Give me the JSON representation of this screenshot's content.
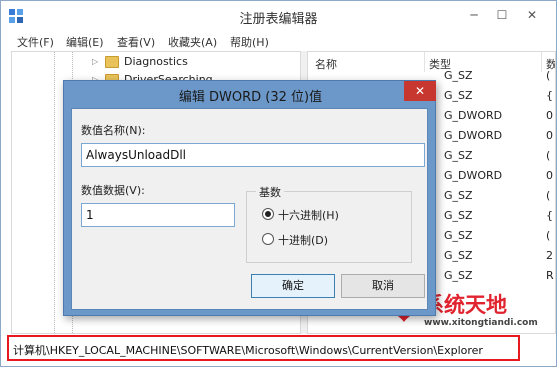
{
  "window": {
    "title": "注册表编辑器",
    "minimize": "─",
    "maximize": "☐",
    "close": "✕"
  },
  "menu": [
    "文件(F)",
    "编辑(E)",
    "查看(V)",
    "收藏夹(A)",
    "帮助(H)"
  ],
  "tree": {
    "items": [
      {
        "label": "Diagnostics"
      },
      {
        "label": "DriverSearching"
      }
    ]
  },
  "list": {
    "columns": [
      "名称",
      "类型",
      "数"
    ],
    "types": [
      "G_SZ",
      "G_SZ",
      "G_DWORD",
      "G_DWORD",
      "G_SZ",
      "G_DWORD",
      "G_SZ",
      "G_SZ",
      "G_SZ",
      "G_SZ",
      "G_SZ"
    ],
    "data": [
      "(",
      "{",
      "0",
      "0",
      "(",
      "0",
      "(",
      "{",
      "(",
      "2",
      "R"
    ]
  },
  "dialog": {
    "title": "编辑 DWORD (32 位)值",
    "close": "✕",
    "name_label": "数值名称(N):",
    "name_value": "AlwaysUnloadDll",
    "data_label": "数值数据(V):",
    "data_value": "1",
    "base_label": "基数",
    "hex_label": "十六进制(H)",
    "dec_label": "十进制(D)",
    "ok": "确定",
    "cancel": "取消"
  },
  "status": {
    "path": "计算机\\HKEY_LOCAL_MACHINE\\SOFTWARE\\Microsoft\\Windows\\CurrentVersion\\Explorer"
  },
  "watermark": {
    "title": "系统天地",
    "url": "www.xitongtiandi.com"
  },
  "colors": {
    "dialog_frame": "#6b97c9",
    "close_red": "#c7372f",
    "status_border": "#e5191e",
    "watermark_red": "#e0232e"
  }
}
